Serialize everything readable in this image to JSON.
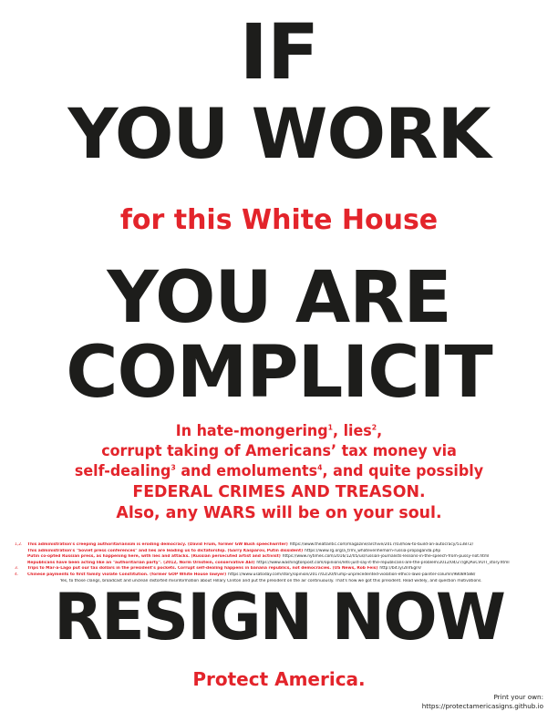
{
  "headline": {
    "line1": "IF",
    "line2": "YOU WORK",
    "subline": "for this White House",
    "line3": "YOU ARE",
    "line4": "COMPLICIT"
  },
  "body": {
    "line1_a": "In hate-mongering",
    "line1_sup1": "1",
    "line1_b": ", lies",
    "line1_sup2": "2",
    "line1_c": ",",
    "line2": "corrupt taking of Americans’ tax money via",
    "line3_a": "self-dealing",
    "line3_sup": "3",
    "line3_b": " and emoluments",
    "line3_sup2": "4",
    "line3_c": ", and quite possibly",
    "line4": "FEDERAL CRIMES AND TREASON.",
    "line5": "Also, any WARS will be on your soul."
  },
  "footnotes": [
    {
      "num": "1,2.",
      "text": "This administration's creeping authoritarianism is eroding democracy. (David Frum, former GW Bush speechwriter)",
      "url": "https://www.theatlantic.com/magazine/archive/2017/03/how-to-build-an-autocracy/513872/"
    },
    {
      "num": "",
      "text": "This administration's \"Soviet press conferences\" and lies are leading us to dictatorship. (Garry Kasparov, Putin dissident)",
      "url": "https://www.rg.org/a_trmi_whatevenhemorn-russia-propaganda.php"
    },
    {
      "num": "",
      "text": "Putin co-opted Russian press, as happening here, with lies and attacks. (Russian persecuted artist and activist)",
      "url": "https://www.nytimes.com/2016/12/05/us/russian-journalists-lessons-in-the-speech-from-pussy-riot.html"
    },
    {
      "num": "",
      "text": "Republicans have been acting like an \"authoritarian party\". (2012, Norm Ornstein, conservative AEI)",
      "url": "https://www.washingtonpost.com/opinions/lets-just-say-it-the-republicans-are-the-problem/2012/04/27/gIQAxCVUlT_story.html"
    },
    {
      "num": "3.",
      "text": "Trips to Mar-a-Lago put our tax dollars in the president's pockets. Corrupt self-dealing happens in banana republics, not democracies. (US News, Rob Feis)",
      "url": "http://bit.ly/2lnfEgnV"
    },
    {
      "num": "4.",
      "text": "Chinese payments to first family violate Constitution. (former GOP White House lawyer)",
      "url": "https://www.usatoday.com/story/opinion/2017/02/20/trump-unprecedented-violation-ethics-laws-painter-column/98089588/"
    }
  ],
  "footnote_extra": "Yes, to those clangs, broadcast and unclean distorted misinformation about Hillary Clinton and put the president on the air continuously. That's how we got this president. Read widely, and question motivations.",
  "resign": "RESIGN NOW",
  "protect": "Protect America.",
  "print": {
    "label": "Print your own:",
    "url": "https://protectamericasigns.github.io"
  },
  "colors": {
    "black": "#1d1d1b",
    "red": "#e3242b"
  }
}
